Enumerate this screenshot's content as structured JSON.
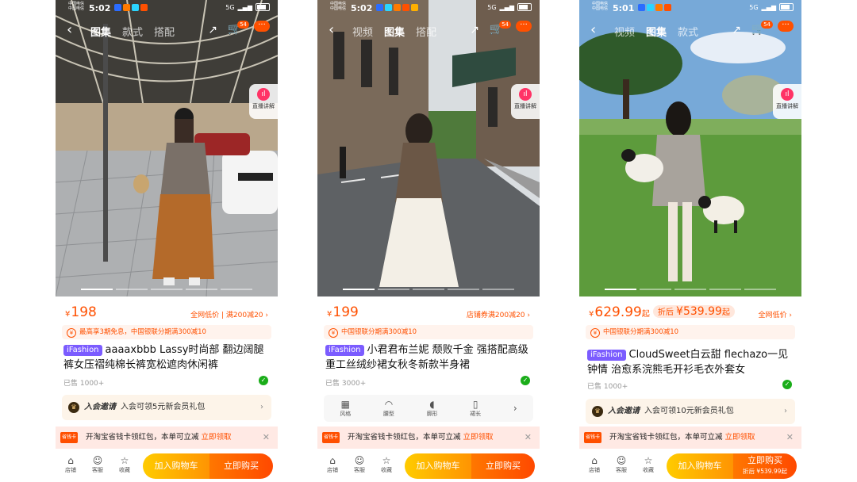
{
  "status": {
    "carrier_line1": "中国电信",
    "carrier_line2": "中国电信",
    "network": "5G",
    "times": [
      "5:02",
      "5:02",
      "5:01"
    ]
  },
  "nav": {
    "back_icon": "chevron-left-icon",
    "share_icon": "share-icon",
    "cart_icon": "cart-icon",
    "cart_count": "54",
    "more_label": "···"
  },
  "live_label": "直播讲解",
  "screens": [
    {
      "tabs": [
        "图集",
        "款式",
        "搭配"
      ],
      "active_tab": "图集",
      "price_symbol": "¥",
      "price": "198",
      "coupon": "全网低价 | 满200减20 ›",
      "promo": "最高享3期免息，中国银联分期满300减10",
      "brand_tag": "iFashion",
      "title": "aaaaxbbb Lassy时尚部 翻边阔腿裤女压褶纯棉长裤宽松遮肉休闲裤",
      "sold": "已售 1000+",
      "member_lead": "入会邀请",
      "member_text": "入会可领5元新会员礼包",
      "banner_tag": "省钱卡",
      "banner_text": "开淘宝省钱卡领红包，本单可立减",
      "banner_link": "立即领取",
      "add_cart": "加入购物车",
      "buy_now": "立即购买",
      "shop": "店铺",
      "service": "客服",
      "favorite": "收藏"
    },
    {
      "tabs": [
        "视频",
        "图集",
        "搭配"
      ],
      "active_tab": "图集",
      "price_symbol": "¥",
      "price": "199",
      "coupon": "店铺券满200减20 ›",
      "promo": "中国银联分期满300减10",
      "brand_tag": "iFashion",
      "title": "小君君布兰妮 颓败千金 强搭配高级重工丝绒纱裙女秋冬新款半身裙",
      "sold": "已售 3000+",
      "categories": [
        "风格",
        "腰型",
        "廓形",
        "裙长"
      ],
      "banner_tag": "省钱卡",
      "banner_text": "开淘宝省钱卡领红包，本单可立减",
      "banner_link": "立即领取",
      "add_cart": "加入购物车",
      "buy_now": "立即购买",
      "shop": "店铺",
      "service": "客服",
      "favorite": "收藏"
    },
    {
      "tabs": [
        "视频",
        "图集",
        "款式"
      ],
      "active_tab": "图集",
      "price_symbol": "¥",
      "price": "629.99",
      "price_suffix": "起",
      "discount_label": "折后",
      "discount_price": "¥539.99",
      "discount_suffix": "起",
      "coupon": "全网低价 ›",
      "promo": "中国银联分期满300减10",
      "brand_tag": "iFashion",
      "title": "CloudSweet白云甜 flechazo一见钟情 治愈系浣熊毛开衫毛衣外套女",
      "sold": "已售 1000+",
      "member_lead": "入会邀请",
      "member_text": "入会可领10元新会员礼包",
      "banner_tag": "省钱卡",
      "banner_text": "开淘宝省钱卡领红包，本单可立减",
      "banner_link": "立即领取",
      "add_cart": "加入购物车",
      "buy_now": "立即购买",
      "buy_sub": "折后 ¥539.99起",
      "shop": "店铺",
      "service": "客服",
      "favorite": "收藏"
    }
  ],
  "colors": {
    "accent": "#ff5000",
    "cart_gradient_start": "#ffcb00",
    "buy_gradient_end": "#ff4900",
    "brand_tag": "#7b5cff"
  }
}
